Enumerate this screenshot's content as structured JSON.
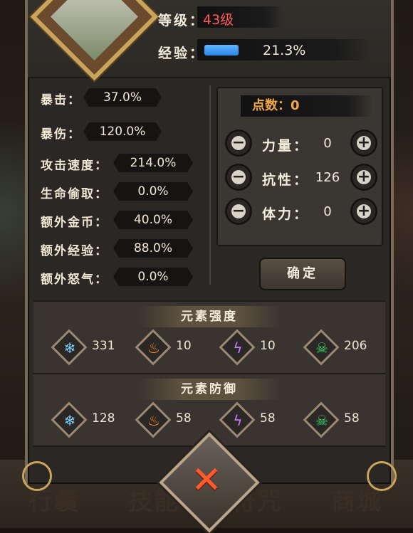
{
  "header": {
    "level_label": "等级：",
    "level_value": "43级",
    "exp_label": "经验：",
    "exp_percent_text": "21.3%",
    "exp_progress": 0.213
  },
  "stats": [
    {
      "label": "暴击：",
      "value": "37.0%"
    },
    {
      "label": "暴伤：",
      "value": "120.0%"
    },
    {
      "label": "攻击速度：",
      "value": "214.0%"
    },
    {
      "label": "生命偷取：",
      "value": "0.0%"
    },
    {
      "label": "额外金币：",
      "value": "40.0%"
    },
    {
      "label": "额外经验：",
      "value": "88.0%"
    },
    {
      "label": "额外怒气：",
      "value": "0.0%"
    }
  ],
  "points": {
    "label": "点数：",
    "value": "0"
  },
  "attributes": [
    {
      "label": "力量：",
      "value": "0"
    },
    {
      "label": "抗性：",
      "value": "126"
    },
    {
      "label": "体力：",
      "value": "0"
    }
  ],
  "confirm_label": "确定",
  "element_strength": {
    "title": "元素强度",
    "values": [
      {
        "icon": "snowflake-icon",
        "value": "331"
      },
      {
        "icon": "fire-icon",
        "value": "10"
      },
      {
        "icon": "lightning-icon",
        "value": "10"
      },
      {
        "icon": "skull-icon",
        "value": "206"
      }
    ]
  },
  "element_defense": {
    "title": "元素防御",
    "values": [
      {
        "icon": "snowflake-icon",
        "value": "128"
      },
      {
        "icon": "fire-icon",
        "value": "58"
      },
      {
        "icon": "lightning-icon",
        "value": "58"
      },
      {
        "icon": "skull-icon",
        "value": "58"
      }
    ]
  },
  "bottom_nav": [
    "行囊",
    "技能",
    "符咒",
    "商城"
  ],
  "colors": {
    "level_red": "#ff5b57",
    "exp_blue": "#3a9af0",
    "points_orange": "#f0a64a",
    "close_x": "#ff5a2b"
  }
}
